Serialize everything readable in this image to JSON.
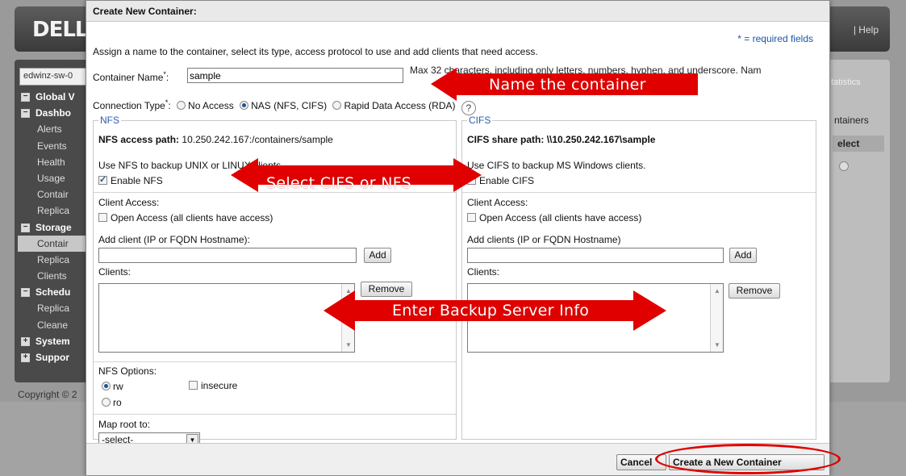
{
  "app": {
    "logo": "DELL",
    "help": "| Help",
    "system_select": "edwinz-sw-0",
    "copyright": "Copyright © 2",
    "right_panel": {
      "statistics": "tatistics",
      "containers": "ntainers",
      "select": "elect"
    },
    "nav": [
      {
        "label": "Global V",
        "type": "group",
        "toggle": "−"
      },
      {
        "label": "Dashbo",
        "type": "group",
        "toggle": "−"
      },
      {
        "label": "Alerts",
        "type": "sub"
      },
      {
        "label": "Events",
        "type": "sub"
      },
      {
        "label": "Health",
        "type": "sub"
      },
      {
        "label": "Usage",
        "type": "sub"
      },
      {
        "label": "Contair",
        "type": "sub"
      },
      {
        "label": "Replica",
        "type": "sub"
      },
      {
        "label": "Storage",
        "type": "group",
        "toggle": "−"
      },
      {
        "label": "Contair",
        "type": "sub",
        "selected": true
      },
      {
        "label": "Replica",
        "type": "sub"
      },
      {
        "label": "Clients",
        "type": "sub"
      },
      {
        "label": "Schedu",
        "type": "group",
        "toggle": "−"
      },
      {
        "label": "Replica",
        "type": "sub"
      },
      {
        "label": "Cleane",
        "type": "sub"
      },
      {
        "label": "System",
        "type": "group",
        "toggle": "+"
      },
      {
        "label": "Suppor",
        "type": "group",
        "toggle": "+"
      }
    ]
  },
  "dialog": {
    "title": "Create New Container:",
    "required_note": "* = required fields",
    "intro": "Assign a name to the container, select its type, access protocol to use and add clients that need access.",
    "name_label": "Container Name",
    "name_value": "sample",
    "name_help": "Max 32 characters, including only letters, numbers, hyphen, and underscore. Nam",
    "connection_label": "Connection Type",
    "connection_options": [
      "No Access",
      "NAS (NFS, CIFS)",
      "Rapid Data Access (RDA)"
    ],
    "connection_selected": "NAS (NFS, CIFS)",
    "help_icon": "?",
    "nfs": {
      "legend": "NFS",
      "path_label": "NFS access path:",
      "path_value": "10.250.242.167:/containers/sample",
      "use_text": "Use NFS to backup UNIX or LINUX clients.",
      "enable_label": "Enable NFS",
      "enable_checked": true,
      "client_access_label": "Client Access:",
      "open_access_label": "Open Access (all clients have access)",
      "add_client_label": "Add client (IP or FQDN Hostname):",
      "add_button": "Add",
      "clients_label": "Clients:",
      "remove_button": "Remove",
      "options_label": "NFS Options:",
      "opt_rw": "rw",
      "opt_ro": "ro",
      "opt_insecure": "insecure",
      "map_root_label": "Map root to:",
      "map_root_value": "-select-"
    },
    "cifs": {
      "legend": "CIFS",
      "path_label": "CIFS share path:",
      "path_value": "\\\\10.250.242.167\\sample",
      "use_text": "Use CIFS to backup MS Windows clients.",
      "enable_label": "Enable CIFS",
      "client_access_label": "Client Access:",
      "open_access_label": "Open Access (all clients have access)",
      "add_client_label": "Add clients (IP or FQDN Hostname)",
      "add_button": "Add",
      "clients_label": "Clients:",
      "remove_button": "Remove"
    },
    "footer": {
      "cancel": "Cancel",
      "create": "Create a New Container"
    }
  },
  "annotations": {
    "name_arrow": "Name the container",
    "type_arrow": "Select CIFS or NFS",
    "backup_arrow": "Enter Backup Server Info",
    "color": "#e00000"
  }
}
